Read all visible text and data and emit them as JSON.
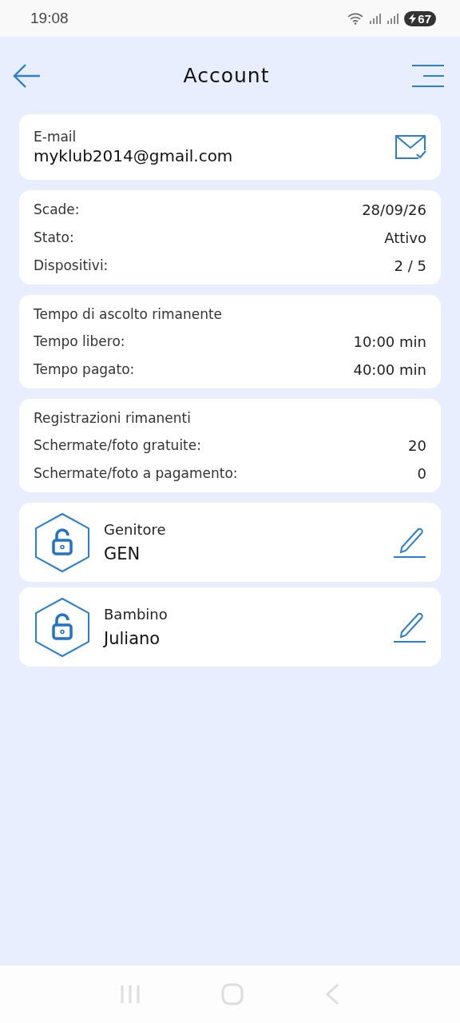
{
  "status_bar": {
    "time": "19:08",
    "battery": "67"
  },
  "header": {
    "title": "Account"
  },
  "email": {
    "label": "E-mail",
    "value": "myklub2014@gmail.com"
  },
  "sections": [
    {
      "rows": [
        {
          "label": "Scade:",
          "value": "28/09/26"
        },
        {
          "label": "Stato:",
          "value": "Attivo"
        },
        {
          "label": "Dispositivi:",
          "value": "2 / 5"
        }
      ]
    },
    {
      "heading": "Tempo di ascolto rimanente",
      "rows": [
        {
          "label": "Tempo libero:",
          "value": "10:00 min"
        },
        {
          "label": "Tempo pagato:",
          "value": "40:00 min"
        }
      ]
    },
    {
      "heading": "Registrazioni rimanenti",
      "rows": [
        {
          "label": "Schermate/foto gratuite:",
          "value": "20"
        },
        {
          "label": "Schermate/foto a pagamento:",
          "value": "0"
        }
      ]
    }
  ],
  "profiles": [
    {
      "role": "Genitore",
      "name": "GEN"
    },
    {
      "role": "Bambino",
      "name": "Juliano"
    }
  ]
}
